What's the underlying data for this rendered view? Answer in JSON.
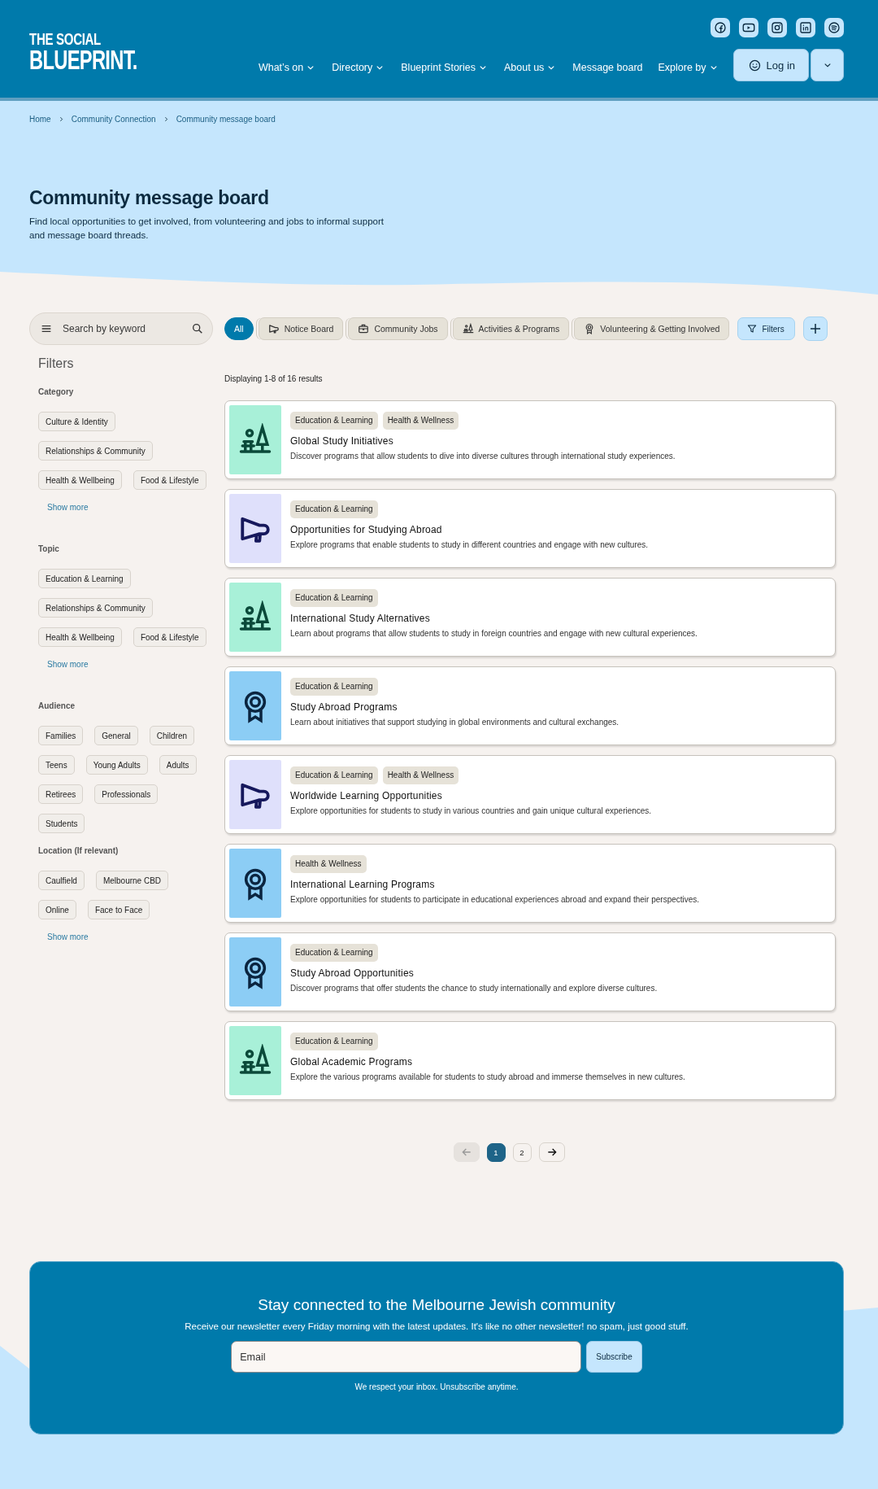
{
  "header": {
    "logo": [
      "THE SOCIAL",
      "BLUEPRINT."
    ],
    "nav": [
      {
        "label": "What’s on",
        "dropdown": true
      },
      {
        "label": "Directory",
        "dropdown": true
      },
      {
        "label": "Blueprint Stories",
        "dropdown": true
      },
      {
        "label": "About us",
        "dropdown": true
      },
      {
        "label": "Message board",
        "dropdown": false
      },
      {
        "label": "Explore by",
        "dropdown": true
      }
    ],
    "login": {
      "label": "Log in"
    }
  },
  "breadcrumb": [
    "Home",
    "Community Connection",
    "Community message board"
  ],
  "hero": {
    "title": "Community message board",
    "description": "Find local opportunities to get involved, from volunteering and jobs to informal support and message board threads."
  },
  "search": {
    "placeholder": "Search by keyword"
  },
  "chips": [
    {
      "label": "All",
      "kind": "all",
      "selected": true
    },
    {
      "label": "Notice Board",
      "kind": "notice",
      "selected": false
    },
    {
      "label": "Community Jobs",
      "kind": "jobs",
      "selected": false
    },
    {
      "label": "Activities & Programs",
      "kind": "activities",
      "selected": false
    },
    {
      "label": "Volunteering & Getting Involved",
      "kind": "volunteering",
      "selected": false
    }
  ],
  "filters_button": {
    "label": "Filters"
  },
  "sidebar": {
    "title": "Filters",
    "groups": [
      {
        "title": "Category",
        "options": [
          "Culture & Identity",
          "Relationships & Community",
          "Health & Wellbeing",
          "Food & Lifestyle"
        ],
        "show_more": "Show more"
      },
      {
        "title": "Topic",
        "options": [
          "Education & Learning",
          "Relationships & Community",
          "Health & Wellbeing",
          "Food & Lifestyle"
        ],
        "show_more": "Show more"
      },
      {
        "title": "Audience",
        "options": [
          "Families",
          "General",
          "Children",
          "Teens",
          "Young Adults",
          "Adults",
          "Retirees",
          "Professionals",
          "Students"
        ]
      },
      {
        "title": "Location (If relevant)",
        "options": [
          "Caulfield",
          "Melbourne CBD",
          "Online",
          "Face to Face"
        ],
        "show_more": "Show more"
      }
    ]
  },
  "results_summary": "Displaying 1-8 of 16 results",
  "cards": [
    {
      "kind": "activities",
      "tags": [
        "Education & Learning",
        "Health & Wellness"
      ],
      "title": "Global Study Initiatives",
      "description": "Discover programs that allow students to dive into diverse cultures through international study experiences."
    },
    {
      "kind": "notice",
      "tags": [
        "Education & Learning"
      ],
      "title": "Opportunities for Studying Abroad",
      "description": "Explore programs that enable students to study in different countries and engage with new cultures."
    },
    {
      "kind": "activities",
      "tags": [
        "Education & Learning"
      ],
      "title": "International Study Alternatives",
      "description": "Learn about programs that allow students to study in foreign countries and engage with new cultural experiences."
    },
    {
      "kind": "volunteering",
      "tags": [
        "Education & Learning"
      ],
      "title": "Study Abroad Programs",
      "description": "Learn about initiatives that support studying in global environments and cultural exchanges."
    },
    {
      "kind": "notice",
      "tags": [
        "Education & Learning",
        "Health & Wellness"
      ],
      "title": "Worldwide Learning Opportunities",
      "description": "Explore opportunities for students to study in various countries and gain unique cultural experiences."
    },
    {
      "kind": "volunteering",
      "tags": [
        "Health & Wellness"
      ],
      "title": "International Learning Programs",
      "description": "Explore opportunities for students to participate in educational experiences abroad and expand their perspectives."
    },
    {
      "kind": "volunteering",
      "tags": [
        "Education & Learning"
      ],
      "title": "Study Abroad Opportunities",
      "description": "Discover programs that offer students the chance to study internationally and explore diverse cultures."
    },
    {
      "kind": "activities",
      "tags": [
        "Education & Learning"
      ],
      "title": "Global Academic Programs",
      "description": "Explore the various programs available for students to study abroad and immerse themselves in new cultures."
    }
  ],
  "pagination": {
    "previous": {
      "disabled": true
    },
    "pages": [
      {
        "label": "1",
        "selected": true
      },
      {
        "label": "2",
        "selected": false
      }
    ],
    "next": {
      "disabled": false
    }
  },
  "newsletter": {
    "title": "Stay connected to the Melbourne Jewish community",
    "text": "Receive our newsletter every Friday morning with the latest updates. It's like no other newsletter! no spam, just good stuff.",
    "email_placeholder": "Email",
    "button": "Subscribe",
    "note": "We respect your inbox. Unsubscribe anytime."
  }
}
